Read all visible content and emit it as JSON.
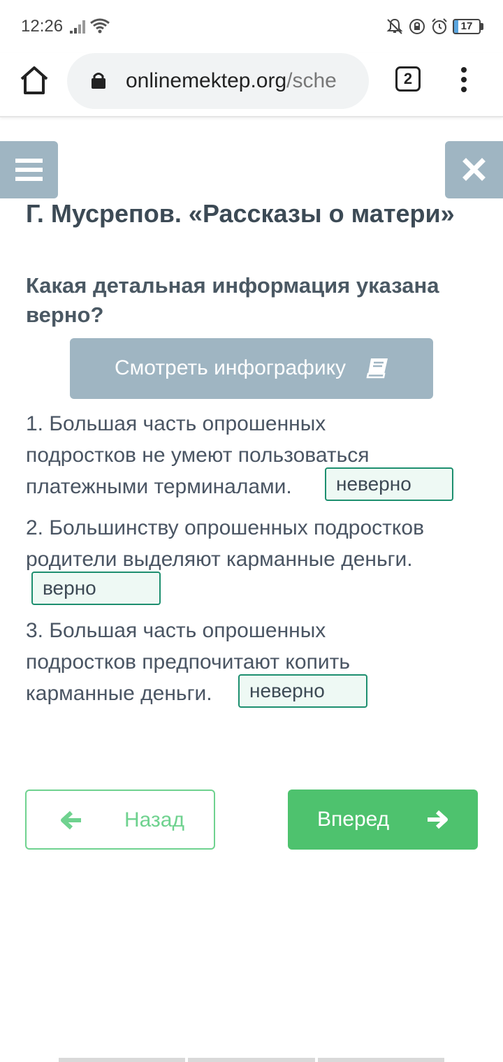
{
  "status_bar": {
    "time": "12:26",
    "battery": "17",
    "battery_level": 0.17,
    "icons": [
      "signal-icon",
      "wifi-icon",
      "notifications-off-icon",
      "data-saver-icon",
      "alarm-icon",
      "battery-icon"
    ]
  },
  "browser": {
    "url_host": "onlinemektep.org",
    "url_path": "/sche",
    "tab_count": "2"
  },
  "page": {
    "title": "Г. Мусрепов. «Рассказы о матери»",
    "question": "Какая детальная информация указана верно?",
    "infographic_button": "Смотреть инфографику",
    "items": [
      {
        "text": "1. Большая часть опрошенных подростков не умеют пользоваться платежными терминалами.",
        "answer": "неверно"
      },
      {
        "text": "2. Большинству опрошенных подростков родители выделяют карманные деньги.",
        "answer": "верно"
      },
      {
        "text": "3. Большая часть опрошенных подростков предпочитают копить карманные деньги.",
        "answer": "неверно"
      }
    ],
    "back_button": "Назад",
    "next_button": "Вперед"
  },
  "colors": {
    "accent_green": "#4ec26e",
    "panel_blue_gray": "#9fb5c2",
    "answer_border": "#1d8f6f"
  }
}
